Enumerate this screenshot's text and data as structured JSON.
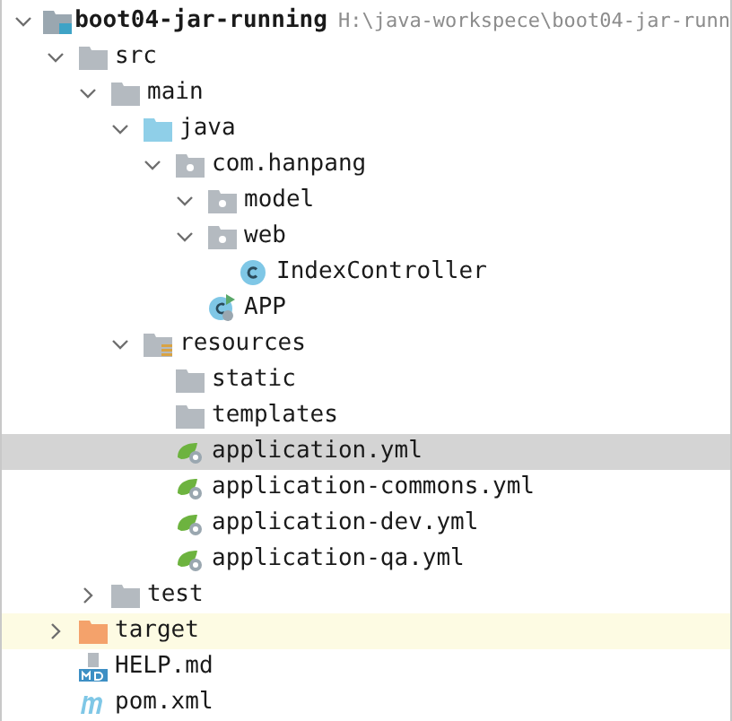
{
  "project_tree": [
    {
      "label": "boot04-jar-running",
      "path": "H:\\java-workspece\\boot04-jar-runn",
      "kind": "module",
      "expanded": true,
      "selected": false,
      "children": [
        {
          "label": "src",
          "kind": "folder",
          "expanded": true,
          "selected": false,
          "children": [
            {
              "label": "main",
              "kind": "folder",
              "expanded": true,
              "selected": false,
              "children": [
                {
                  "label": "java",
                  "kind": "source-folder",
                  "expanded": true,
                  "selected": false,
                  "children": [
                    {
                      "label": "com.hanpang",
                      "kind": "package",
                      "expanded": true,
                      "selected": false,
                      "children": [
                        {
                          "label": "model",
                          "kind": "package",
                          "expanded": true,
                          "selected": false
                        },
                        {
                          "label": "web",
                          "kind": "package",
                          "expanded": true,
                          "selected": false,
                          "children": [
                            {
                              "label": "IndexController",
                              "kind": "class",
                              "selected": false
                            }
                          ]
                        },
                        {
                          "label": "APP",
                          "kind": "app-class",
                          "selected": false
                        }
                      ]
                    }
                  ]
                },
                {
                  "label": "resources",
                  "kind": "resources-folder",
                  "expanded": true,
                  "selected": false,
                  "children": [
                    {
                      "label": "static",
                      "kind": "folder-plain",
                      "selected": false
                    },
                    {
                      "label": "templates",
                      "kind": "folder-plain",
                      "selected": false
                    },
                    {
                      "label": "application.yml",
                      "kind": "spring-config",
                      "selected": true
                    },
                    {
                      "label": "application-commons.yml",
                      "kind": "spring-config",
                      "selected": false
                    },
                    {
                      "label": "application-dev.yml",
                      "kind": "spring-config",
                      "selected": false
                    },
                    {
                      "label": "application-qa.yml",
                      "kind": "spring-config",
                      "selected": false
                    }
                  ]
                }
              ]
            },
            {
              "label": "test",
              "kind": "folder",
              "expanded": false,
              "selected": false
            }
          ]
        },
        {
          "label": "target",
          "kind": "excluded-folder",
          "expanded": false,
          "selected": false
        },
        {
          "label": "HELP.md",
          "kind": "markdown",
          "selected": false
        },
        {
          "label": "pom.xml",
          "kind": "maven",
          "selected": false
        }
      ]
    }
  ]
}
